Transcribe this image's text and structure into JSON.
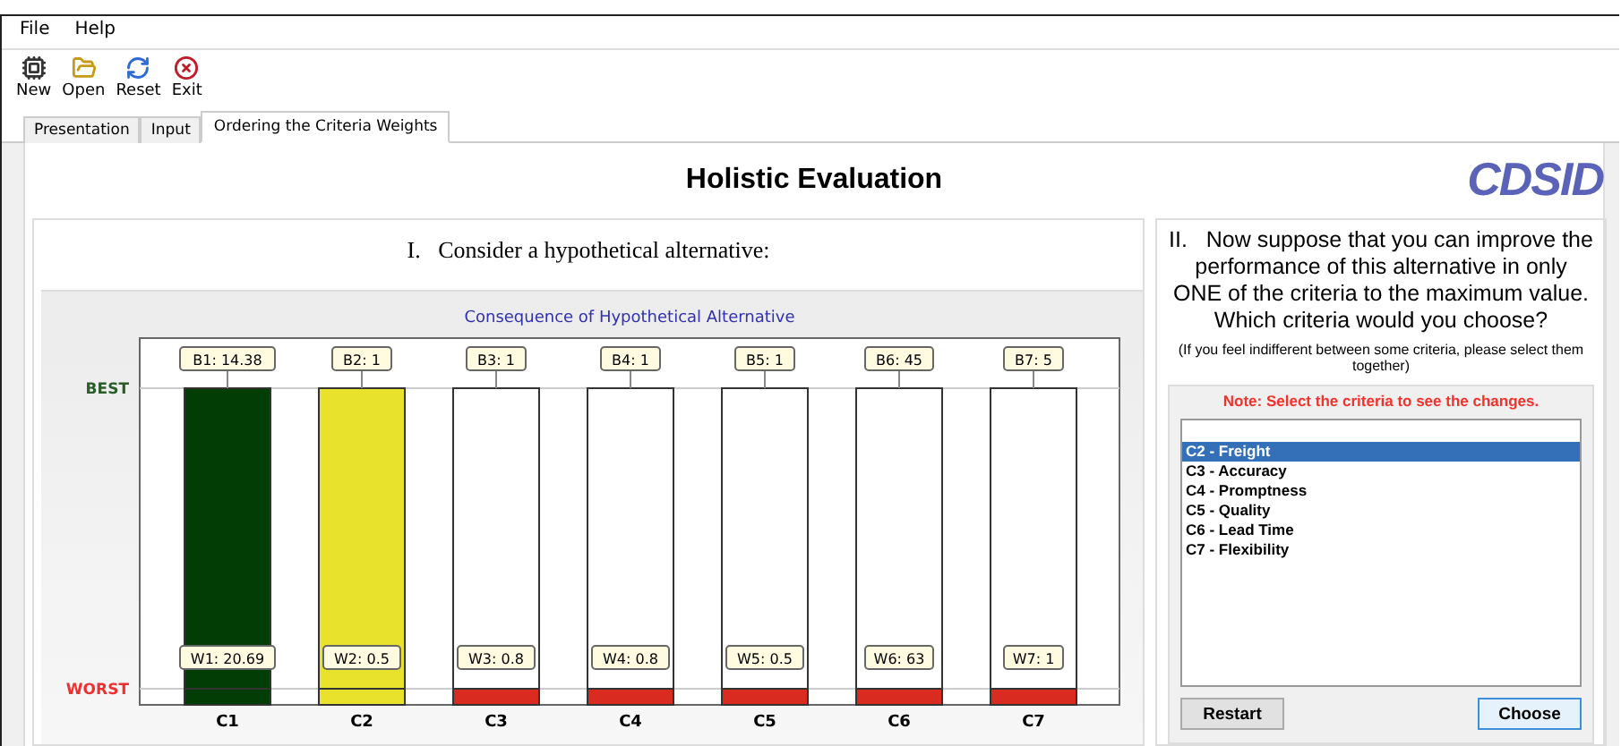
{
  "menu": [
    "File",
    "Help"
  ],
  "toolbar": [
    {
      "label": "New",
      "kind": "new"
    },
    {
      "label": "Open",
      "kind": "open"
    },
    {
      "label": "Reset",
      "kind": "reset"
    },
    {
      "label": "Exit",
      "kind": "exit"
    }
  ],
  "tabs": [
    {
      "label": "Presentation",
      "selected": false
    },
    {
      "label": "Input",
      "selected": false
    },
    {
      "label": "Ordering the Criteria Weights",
      "selected": true
    }
  ],
  "title": "Holistic Evaluation",
  "logo": {
    "text": "CDSID"
  },
  "left_panel": {
    "heading": "I.   Consider a hypothetical alternative:",
    "consequence": {
      "title": "Consequence of Hypothetical Alternative",
      "best_label": "BEST",
      "worst_label": "WORST",
      "bars": [
        {
          "criterion": "C1",
          "best": "B1: 14.38",
          "worst": "W1: 20.69",
          "filled": true,
          "color": "#023d06"
        },
        {
          "criterion": "C2",
          "best": "B2: 1",
          "worst": "W2: 0.5",
          "filled": true,
          "color": "#e8e22c"
        },
        {
          "criterion": "C3",
          "best": "B3: 1",
          "worst": "W3: 0.8",
          "filled": false,
          "color": "#d92b1f"
        },
        {
          "criterion": "C4",
          "best": "B4: 1",
          "worst": "W4: 0.8",
          "filled": false,
          "color": "#d92b1f"
        },
        {
          "criterion": "C5",
          "best": "B5: 1",
          "worst": "W5: 0.5",
          "filled": false,
          "color": "#d92b1f"
        },
        {
          "criterion": "C6",
          "best": "B6: 45",
          "worst": "W6: 63",
          "filled": false,
          "color": "#d92b1f"
        },
        {
          "criterion": "C7",
          "best": "B7: 5",
          "worst": "W7: 1",
          "filled": false,
          "color": "#d92b1f"
        }
      ]
    }
  },
  "right_panel": {
    "question": "II.   Now suppose that you can improve the performance of this alternative in only ONE of the criteria to the maximum value. Which criteria would you choose?",
    "hint": "(If you feel indifferent between some criteria, please select them together)",
    "note": "Note: Select the criteria to see the changes.",
    "criteria": [
      {
        "label": "C2 - Freight",
        "selected": true
      },
      {
        "label": "C3 - Accuracy",
        "selected": false
      },
      {
        "label": "C4 - Promptness",
        "selected": false
      },
      {
        "label": "C5 - Quality",
        "selected": false
      },
      {
        "label": "C6 - Lead Time",
        "selected": false
      },
      {
        "label": "C7 - Flexibility",
        "selected": false
      }
    ],
    "buttons": [
      {
        "label": "Restart",
        "primary": false
      },
      {
        "label": "Choose",
        "primary": true
      }
    ]
  }
}
